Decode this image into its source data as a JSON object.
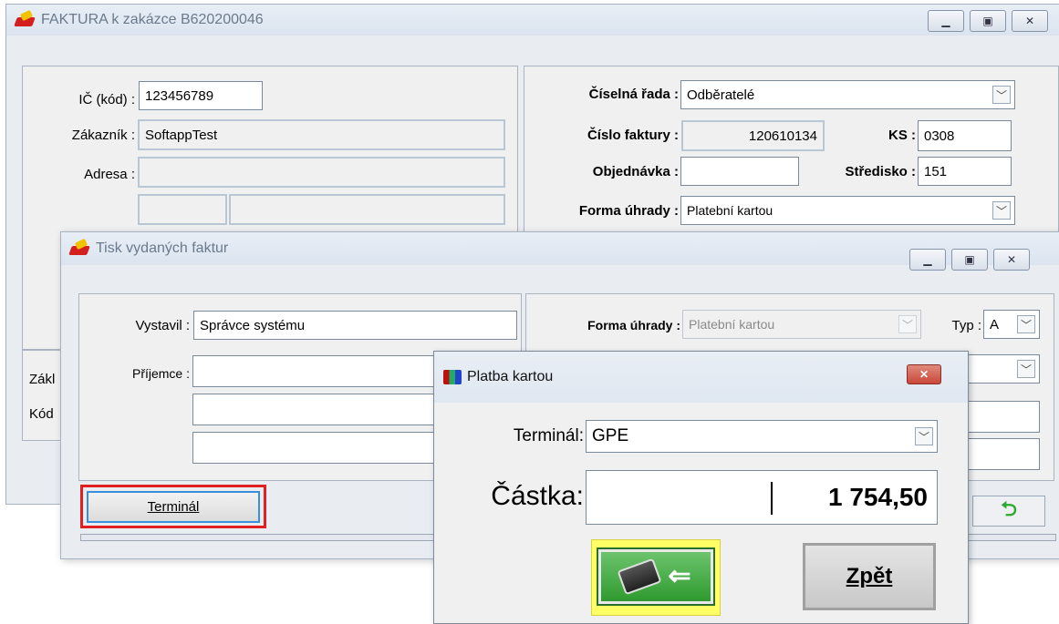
{
  "faktura": {
    "title": "FAKTURA k zakázce B620200046",
    "ic_label": "IČ (kód) :",
    "ic_value": "123456789",
    "zakaznik_label": "Zákazník :",
    "zakaznik_value": "SoftappTest",
    "adresa_label": "Adresa :",
    "adresa_value": "",
    "ciselna_rada_label": "Číselná řada :",
    "ciselna_rada_value": "Odběratelé",
    "cislo_faktury_label": "Číslo faktury :",
    "cislo_faktury_value": "120610134",
    "ks_label": "KS :",
    "ks_value": "0308",
    "objednavka_label": "Objednávka :",
    "objednavka_value": "",
    "stredisko_label": "Středisko :",
    "stredisko_value": "151",
    "forma_uhrady_label": "Forma úhrady :",
    "forma_uhrady_value": "Platební kartou",
    "zakl_label": "Zákl",
    "kod_label": "Kód"
  },
  "tisk": {
    "title": "Tisk vydaných faktur",
    "vystavil_label": "Vystavil :",
    "vystavil_value": "Správce systému",
    "prijemce_label": "Příjemce :",
    "forma_uhrady_label": "Forma úhrady :",
    "forma_uhrady_value": "Platební kartou",
    "typ_label": "Typ :",
    "typ_value": "A",
    "terminal_button": "Terminál"
  },
  "platba": {
    "title": "Platba kartou",
    "terminal_label": "Terminál:",
    "terminal_value": "GPE",
    "castka_label": "Částka:",
    "castka_value": "1 754,50",
    "zpet_button": "Zpět"
  },
  "colors": {
    "highlight_red": "#e02020",
    "highlight_yellow": "#ffff66",
    "close_red": "#c9473a",
    "ok_green": "#3aa03a"
  }
}
